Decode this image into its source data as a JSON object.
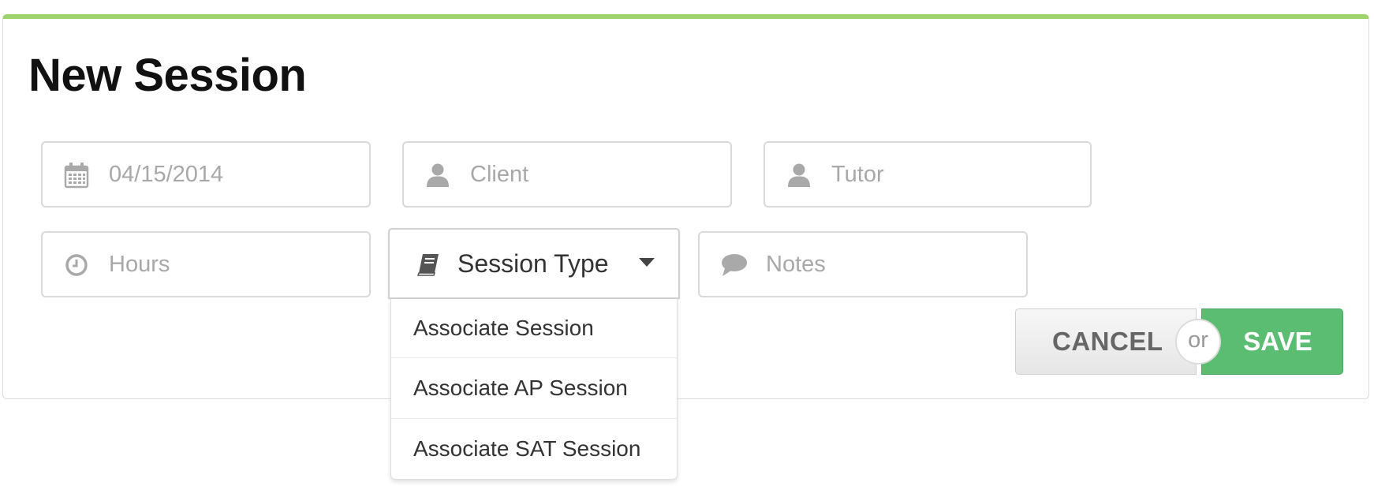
{
  "form": {
    "title": "New Session",
    "date": {
      "value": "04/15/2014",
      "icon": "calendar-icon"
    },
    "client": {
      "placeholder": "Client",
      "icon": "user-icon"
    },
    "tutor": {
      "placeholder": "Tutor",
      "icon": "user-icon"
    },
    "hours": {
      "placeholder": "Hours",
      "icon": "clock-icon"
    },
    "session_type": {
      "label": "Session Type",
      "icon": "book-icon",
      "options": [
        "Associate Session",
        "Associate AP Session",
        "Associate SAT Session"
      ]
    },
    "notes": {
      "placeholder": "Notes",
      "icon": "comment-icon"
    }
  },
  "actions": {
    "cancel_label": "CANCEL",
    "or_label": "or",
    "save_label": "SAVE"
  },
  "colors": {
    "accent_bar": "#9dd46e",
    "save_green": "#5bbd72",
    "placeholder_gray": "#a8a8a8",
    "icon_gray": "#a9a9a9"
  }
}
